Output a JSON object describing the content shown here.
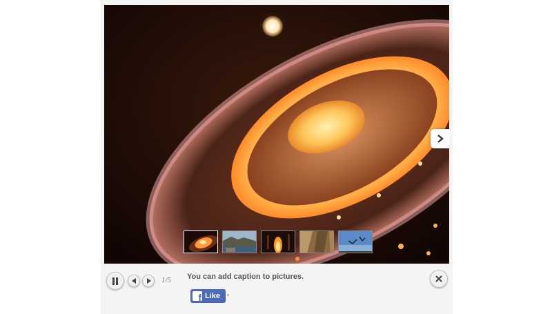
{
  "lightbox": {
    "caption": "You can add caption to pictures.",
    "counter": "1/5",
    "like_label": "Like",
    "fb_letter": "f"
  },
  "thumbnails": [
    {
      "name": "thumb-ceiling-light",
      "active": true
    },
    {
      "name": "thumb-coastline",
      "active": false
    },
    {
      "name": "thumb-fire",
      "active": false
    },
    {
      "name": "thumb-rocks",
      "active": false
    },
    {
      "name": "thumb-sky",
      "active": false
    }
  ],
  "colors": {
    "fb_blue": "#4c69ba",
    "glow": "#ffb24a",
    "background": "#f4f4f4"
  },
  "icons": [
    "pause-icon",
    "prev-icon",
    "next-icon",
    "close-icon",
    "chevron-right-icon",
    "facebook-icon"
  ]
}
